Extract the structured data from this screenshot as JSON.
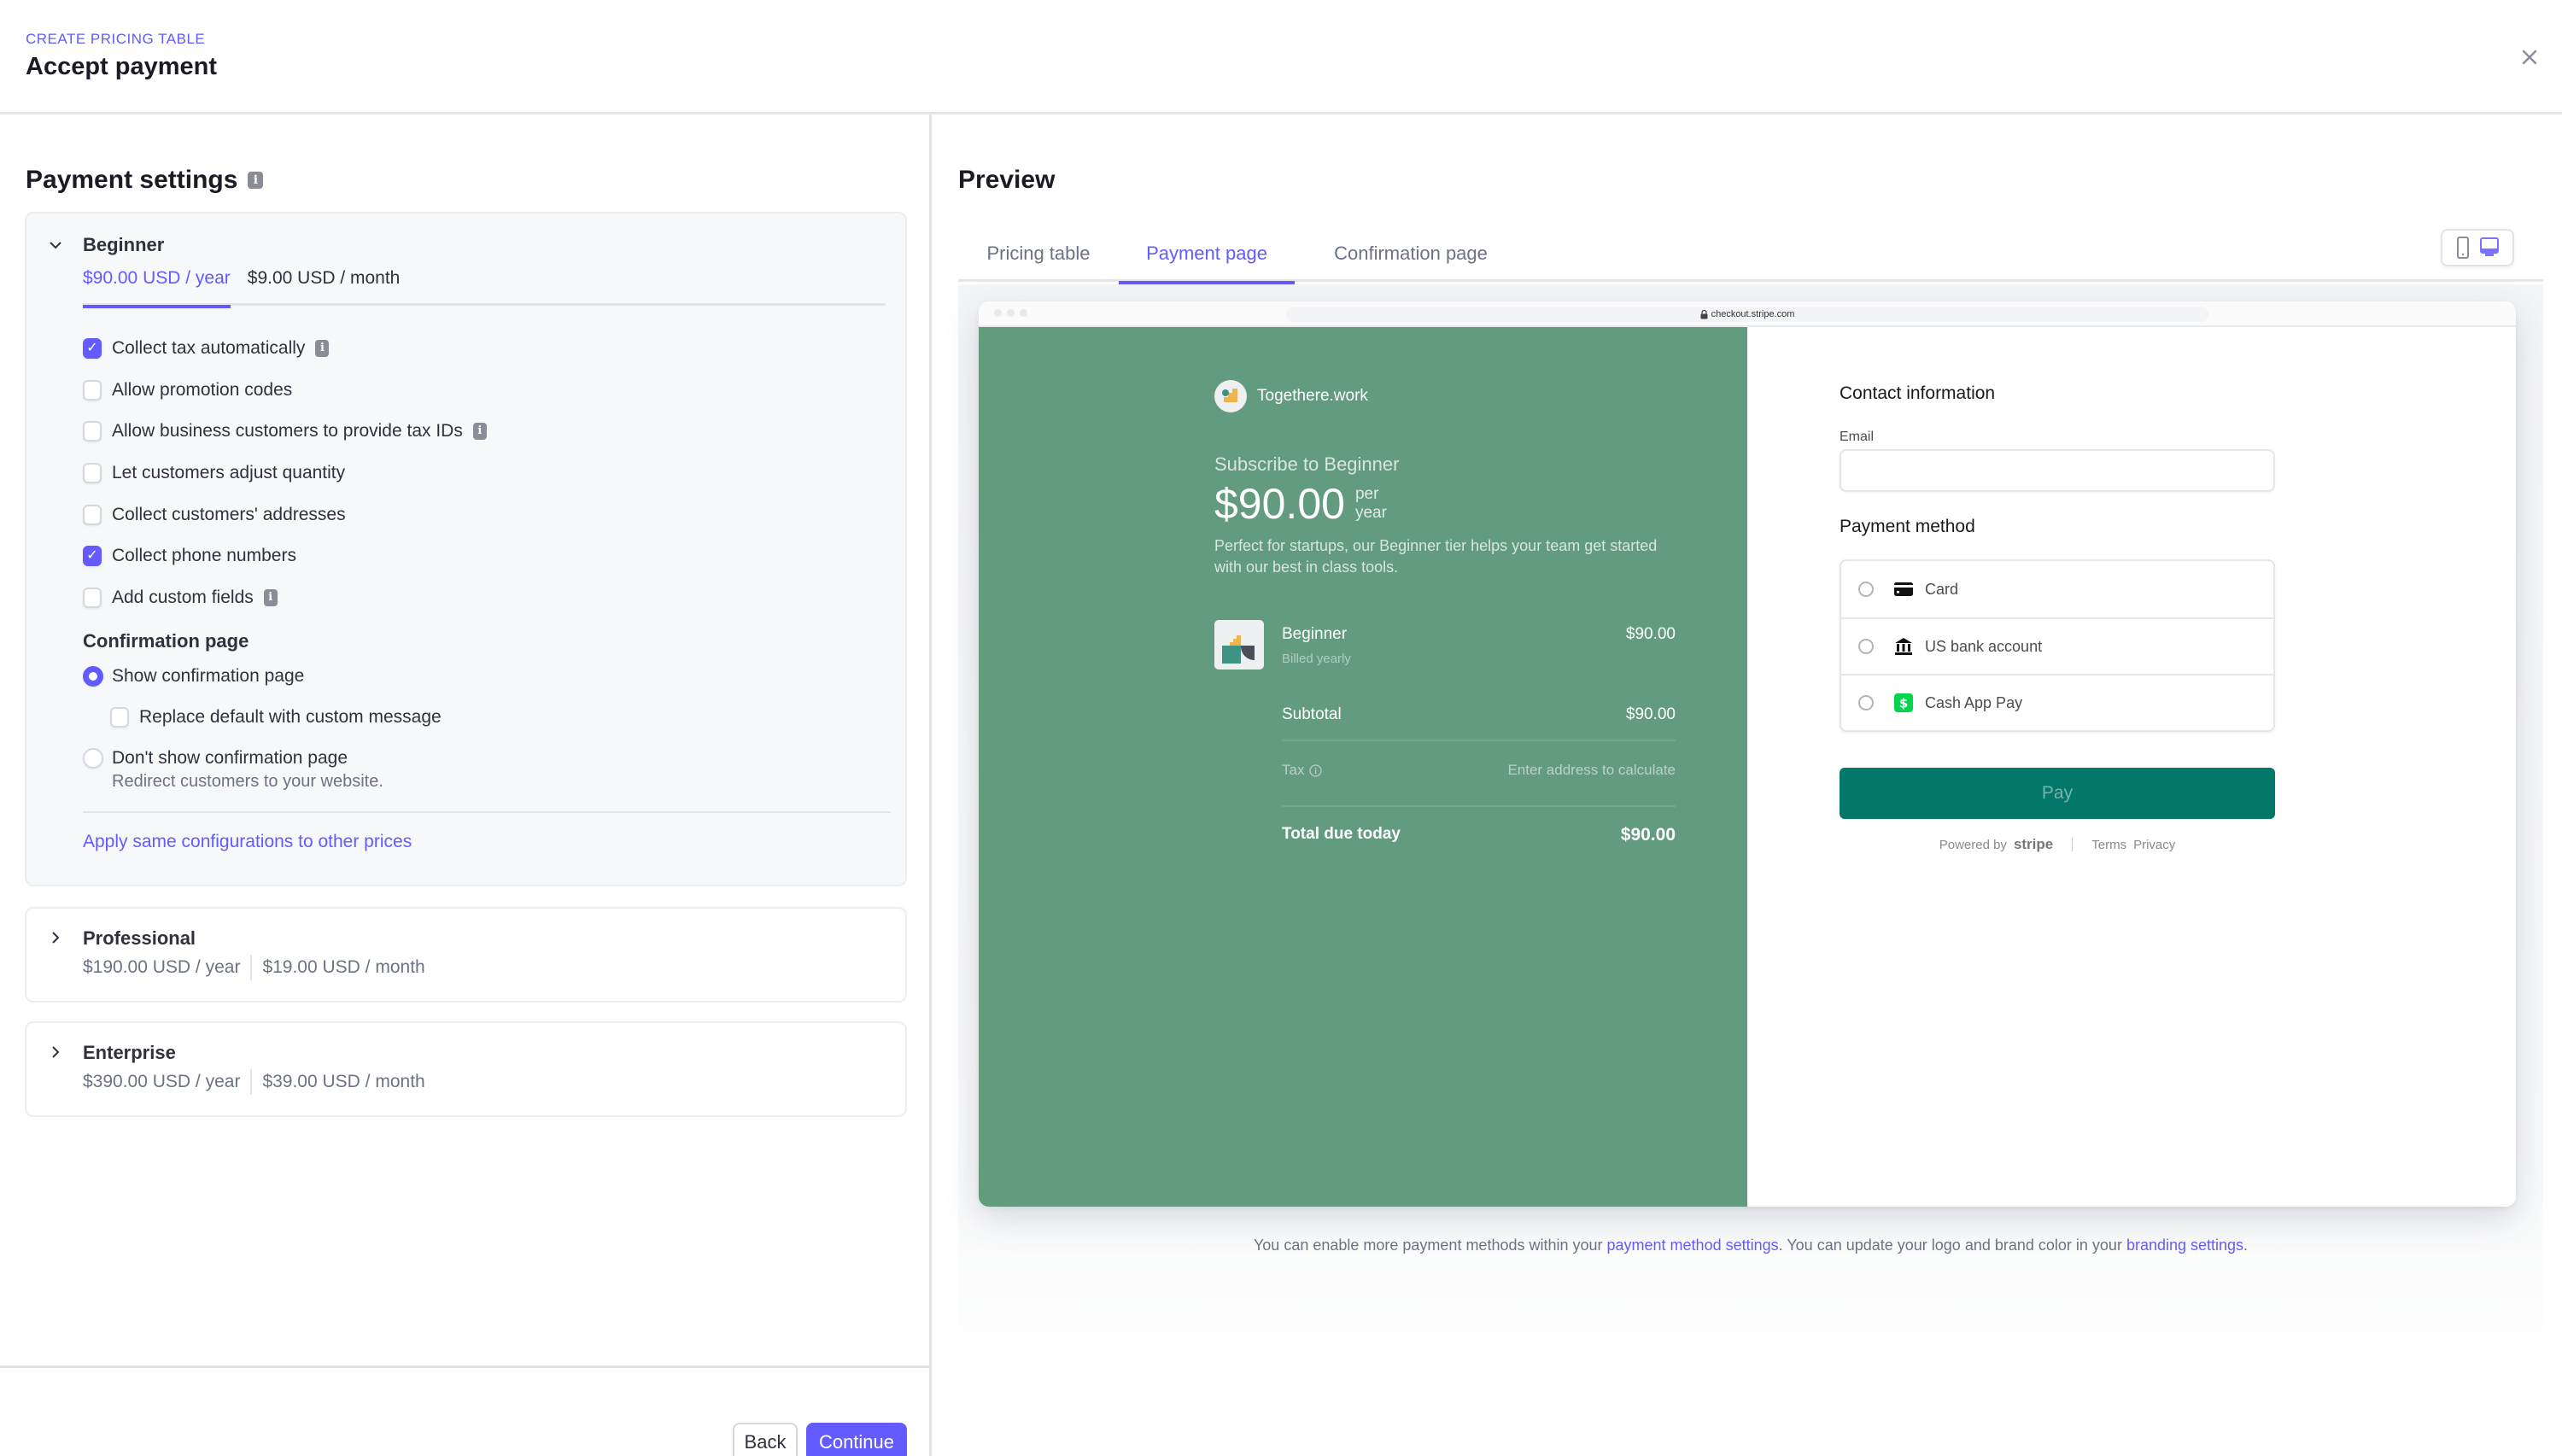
{
  "header": {
    "eyebrow": "CREATE PRICING TABLE",
    "title": "Accept payment"
  },
  "left": {
    "section_title": "Payment settings",
    "plans": [
      {
        "name": "Beginner",
        "expanded": true,
        "prices": [
          "$90.00 USD / year",
          "$9.00 USD / month"
        ],
        "active_price": 0
      },
      {
        "name": "Professional",
        "expanded": false,
        "prices": [
          "$190.00 USD / year",
          "$19.00 USD / month"
        ]
      },
      {
        "name": "Enterprise",
        "expanded": false,
        "prices": [
          "$390.00 USD / year",
          "$39.00 USD / month"
        ]
      }
    ],
    "options": [
      {
        "label": "Collect tax automatically",
        "checked": true,
        "info": true
      },
      {
        "label": "Allow promotion codes",
        "checked": false,
        "info": false
      },
      {
        "label": "Allow business customers to provide tax IDs",
        "checked": false,
        "info": true
      },
      {
        "label": "Let customers adjust quantity",
        "checked": false,
        "info": false
      },
      {
        "label": "Collect customers' addresses",
        "checked": false,
        "info": false
      },
      {
        "label": "Collect phone numbers",
        "checked": true,
        "info": false
      },
      {
        "label": "Add custom fields",
        "checked": false,
        "info": true
      }
    ],
    "confirmation": {
      "title": "Confirmation page",
      "show_label": "Show confirmation page",
      "show_selected": true,
      "replace_label": "Replace default with custom message",
      "replace_checked": false,
      "hide_label": "Don't show confirmation page",
      "hide_sub": "Redirect customers to your website."
    },
    "apply_link": "Apply same configurations to other prices",
    "back_label": "Back",
    "continue_label": "Continue"
  },
  "preview": {
    "title": "Preview",
    "tabs": [
      "Pricing table",
      "Payment page",
      "Confirmation page"
    ],
    "active_tab": 1,
    "device": "desktop",
    "url": "checkout.stripe.com",
    "checkout": {
      "brand_name": "Togethere.work",
      "subscribe": "Subscribe to Beginner",
      "price": "$90.00",
      "per_1": "per",
      "per_2": "year",
      "description": "Perfect for startups, our Beginner tier helps your team get started with our best in class tools.",
      "line_item": {
        "name": "Beginner",
        "sub": "Billed yearly",
        "amount": "$90.00"
      },
      "subtotal_label": "Subtotal",
      "subtotal": "$90.00",
      "tax_label": "Tax",
      "tax_value": "Enter address to calculate",
      "total_label": "Total due today",
      "total": "$90.00",
      "contact_title": "Contact information",
      "email_label": "Email",
      "email_value": "",
      "payment_title": "Payment method",
      "methods": [
        {
          "label": "Card",
          "icon": "credit-card-icon"
        },
        {
          "label": "US bank account",
          "icon": "bank-icon"
        },
        {
          "label": "Cash App Pay",
          "icon": "cash-app-icon"
        }
      ],
      "pay_label": "Pay",
      "powered_by": "Powered by",
      "stripe": "stripe",
      "terms": "Terms",
      "privacy": "Privacy",
      "brand_color": "#629b7e",
      "button_color": "#03776a"
    },
    "note": {
      "part1": "You can enable more payment methods within your ",
      "link1": "payment method settings",
      "part2": ". You can update your logo and brand color in your ",
      "link2": "branding settings",
      "part3": "."
    }
  },
  "colors": {
    "accent": "#635bff",
    "text": "#30313d",
    "muted": "#6a7383"
  }
}
